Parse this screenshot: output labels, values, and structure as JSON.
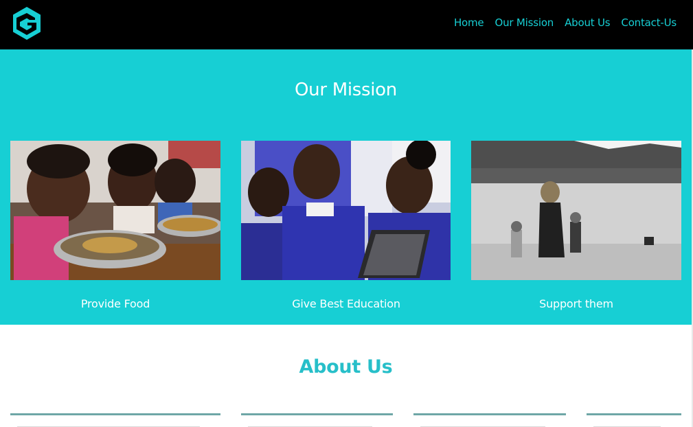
{
  "header": {
    "logo": {
      "icon": "hexagon-g-logo-icon",
      "letter": "G",
      "color": "#17cfd4"
    },
    "nav": [
      {
        "label": "Home"
      },
      {
        "label": "Our Mission"
      },
      {
        "label": "About Us"
      },
      {
        "label": "Contact-Us"
      }
    ]
  },
  "mission": {
    "title": "Our Mission",
    "background": "#17cfd4",
    "cards": [
      {
        "caption": "Provide Food",
        "image": "children-eating-photo"
      },
      {
        "caption": "Give Best Education",
        "image": "students-laptop-photo"
      },
      {
        "caption": "Support them",
        "image": "beach-family-photo"
      }
    ]
  },
  "about": {
    "title": "About Us",
    "title_color": "#27bfc9"
  }
}
